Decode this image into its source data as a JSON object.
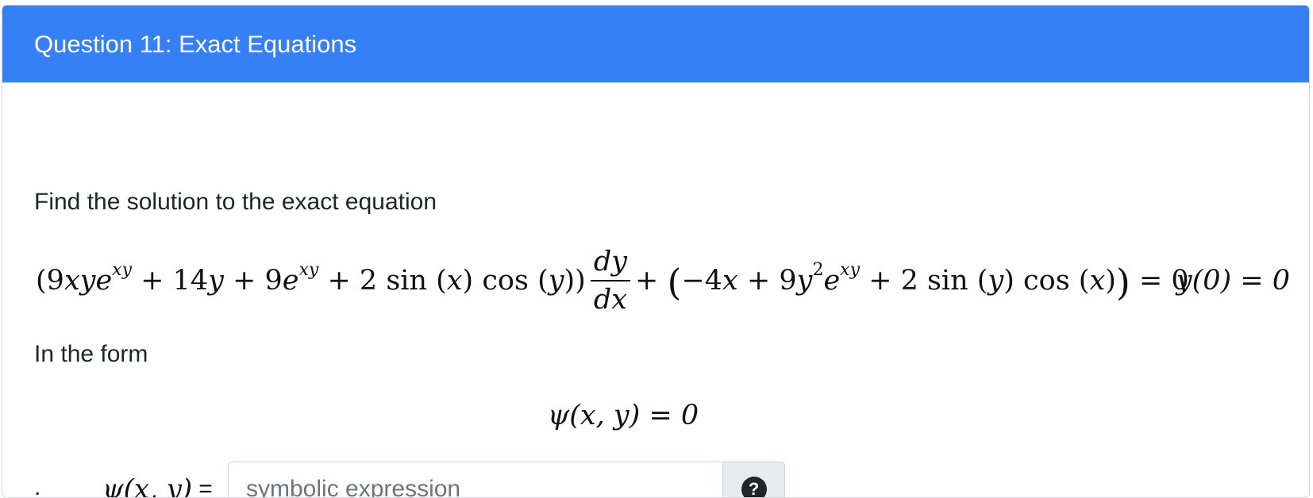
{
  "header": {
    "title": "Question 11: Exact Equations"
  },
  "body": {
    "prompt": "Find the solution to the exact equation",
    "form_label": "In the form",
    "equation": {
      "lparen": "(",
      "t1": "9",
      "t1v": "xye",
      "t1sup": "xy",
      "t2": " + 14",
      "t2v": "y",
      "t3": " + 9",
      "t3v": "e",
      "t3sup": "xy",
      "t4": " + 2 sin (",
      "t4v": "x",
      "t5": ") cos (",
      "t5v": "y",
      "t6": "))",
      "frac_num": "dy",
      "frac_den": "dx",
      "t7": "+ ",
      "bigl": "(",
      "t8": "−4",
      "t8v": "x",
      "t9": " + 9",
      "t9v": "y",
      "t9sup": "2",
      "t9b": "e",
      "t9bsup": "xy",
      "t10": " + 2 sin (",
      "t10v": "y",
      "t11": ") cos (",
      "t11v": "x",
      "t12": ")",
      "bigr": ")",
      "t13": " = 0"
    },
    "initial_condition": "y(0) = 0",
    "form_equation": "ψ(x, y) = 0"
  },
  "answer": {
    "bullet": ".",
    "label_math": "ψ(x, y)",
    "label_eq": "=",
    "input_value": "",
    "input_placeholder": "symbolic expression",
    "help_symbol": "?"
  }
}
